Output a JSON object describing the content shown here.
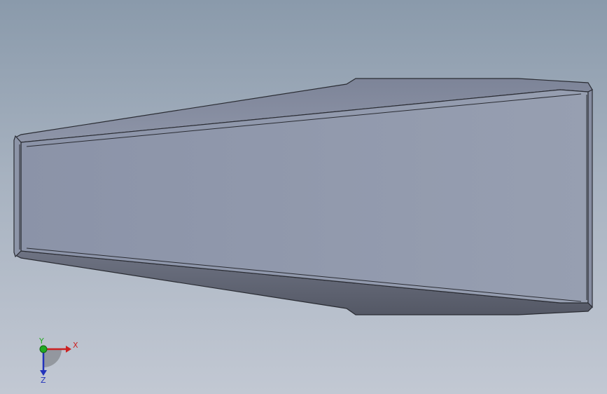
{
  "viewport": {
    "background_top": "#8a9aab",
    "background_bottom": "#c2c8d3"
  },
  "model": {
    "face_color": "#929aad",
    "edge_color": "#2a2c33",
    "bevel_dark": "#5e6270",
    "bevel_light": "#9aa1b3"
  },
  "triad": {
    "x_label": "X",
    "y_label": "Y",
    "z_label": "Z",
    "x_color": "#cc2222",
    "y_color": "#22aa22",
    "z_color": "#2233bb"
  }
}
